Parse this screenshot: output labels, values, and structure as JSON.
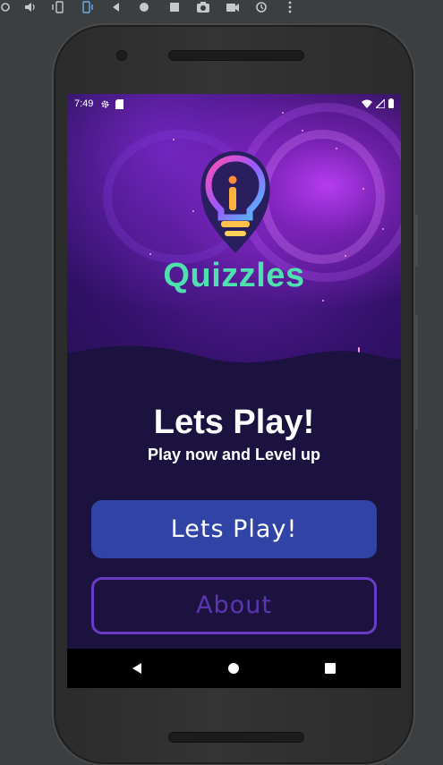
{
  "emulator_toolbar": {
    "icons": [
      "power-icon",
      "volume-icon",
      "rotate-left-icon",
      "rotate-right-icon",
      "back-icon",
      "home-icon",
      "overview-icon",
      "camera-icon",
      "video-icon",
      "history-icon",
      "more-icon"
    ]
  },
  "status_bar": {
    "time": "7:49",
    "icons": [
      "settings-icon",
      "sd-card-icon",
      "wifi-icon",
      "signal-icon",
      "battery-icon"
    ]
  },
  "app": {
    "title": "Quizzles",
    "title_color": "#4fe0b0",
    "heading": "Lets Play!",
    "subheading": "Play now and Level up",
    "primary_button_label": "Lets Play!",
    "secondary_button_label": "About",
    "primary_color": "#3144a5",
    "outline_color": "#6a3bc5"
  },
  "nav_bar": {
    "icons": [
      "back-triangle-icon",
      "home-circle-icon",
      "recents-square-icon"
    ]
  }
}
